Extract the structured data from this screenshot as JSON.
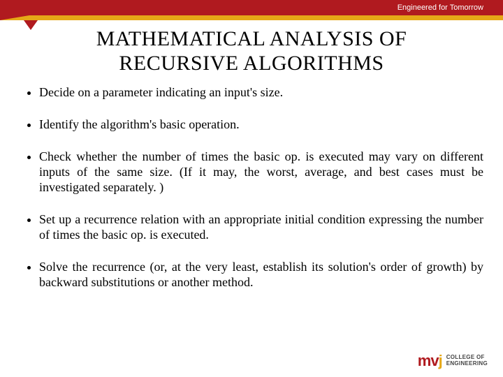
{
  "header": {
    "tagline": "Engineered for Tomorrow"
  },
  "slide": {
    "title_line1": "MATHEMATICAL ANALYSIS OF",
    "title_line2": "RECURSIVE ALGORITHMS"
  },
  "bullets": [
    "Decide on  a parameter indicating an input's size.",
    "Identify the algorithm's basic operation.",
    "Check whether the number of times the basic op. is executed may vary on different inputs of the same size.  (If it may, the worst, average, and best cases must be investigated separately. )",
    "Set up a recurrence relation with an appropriate initial condition expressing the number of times the basic op. is executed.",
    "Solve the recurrence (or, at the very least, establish its solution's order of growth) by backward substitutions or another method."
  ],
  "logo": {
    "mark_m": "m",
    "mark_v": "v",
    "mark_j": "j",
    "line1": "COLLEGE OF",
    "line2": "ENGINEERING"
  }
}
